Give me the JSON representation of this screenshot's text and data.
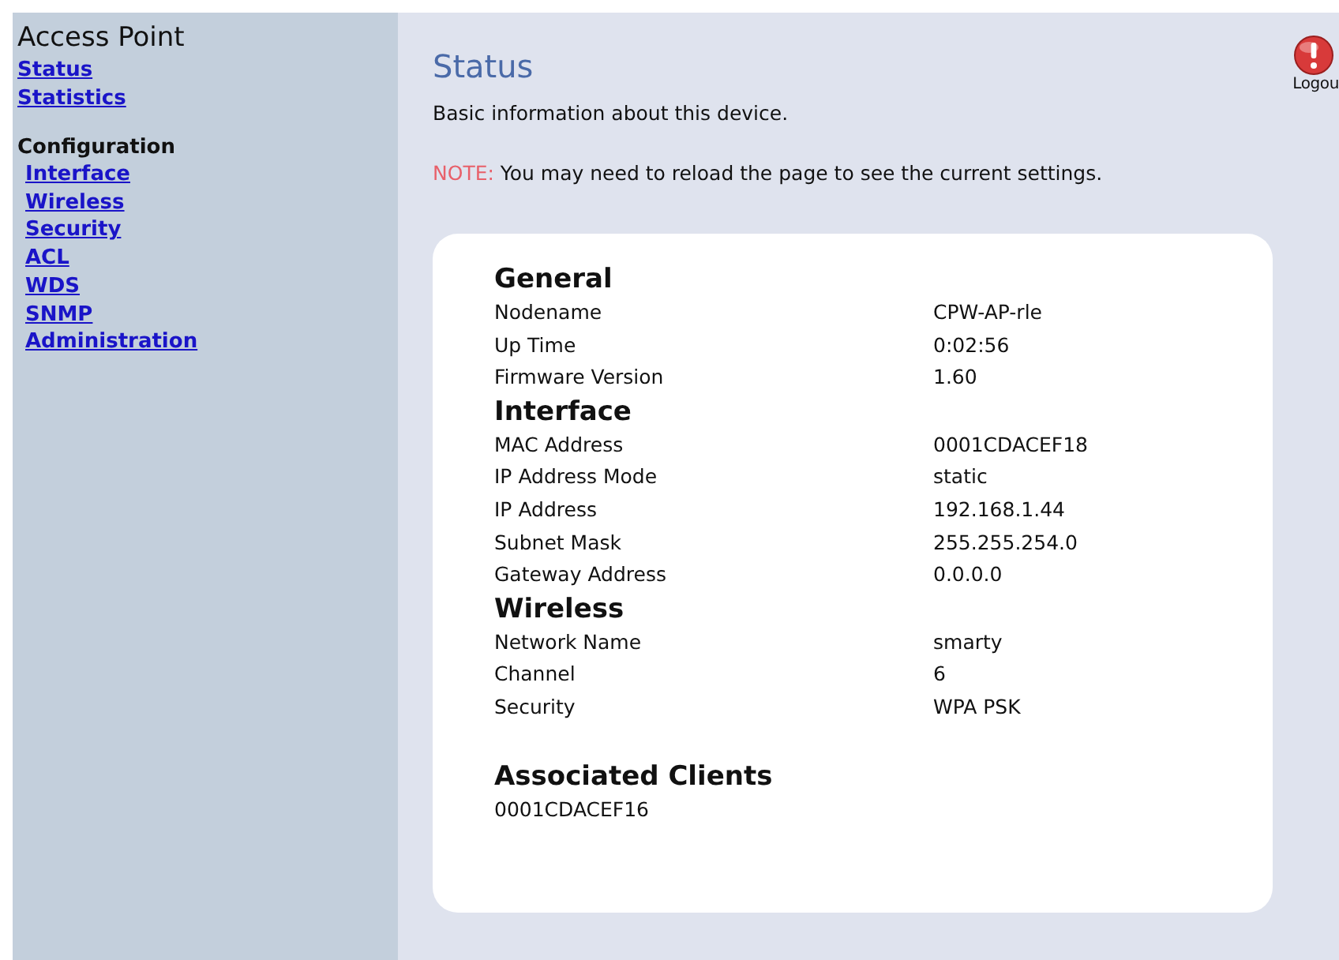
{
  "sidebar": {
    "title": "Access Point",
    "groups": [
      {
        "links": [
          "Status",
          "Statistics"
        ]
      },
      {
        "heading": "Configuration",
        "links": [
          "Interface",
          "Wireless",
          "Security",
          "ACL",
          "WDS",
          "SNMP",
          "Administration"
        ]
      }
    ]
  },
  "page": {
    "title": "Status",
    "description": "Basic information about this device.",
    "note_label": "NOTE:",
    "note": "You may need to reload the page to see the current settings.",
    "logout": "Logou"
  },
  "card": {
    "sections": [
      {
        "heading": "General",
        "rows": [
          {
            "label": "Nodename",
            "value": "CPW-AP-rle"
          },
          {
            "label": "Up Time",
            "value": "0:02:56"
          },
          {
            "label": "Firmware Version",
            "value": "1.60"
          }
        ]
      },
      {
        "heading": "Interface",
        "rows": [
          {
            "label": "MAC Address",
            "value": "0001CDACEF18"
          },
          {
            "label": "IP Address Mode",
            "value": "static"
          },
          {
            "label": "IP Address",
            "value": "192.168.1.44"
          },
          {
            "label": "Subnet Mask",
            "value": "255.255.254.0"
          },
          {
            "label": "Gateway Address",
            "value": "0.0.0.0"
          }
        ]
      },
      {
        "heading": "Wireless",
        "rows": [
          {
            "label": "Network Name",
            "value": "smarty"
          },
          {
            "label": "Channel",
            "value": "6"
          },
          {
            "label": "Security",
            "value": "WPA PSK"
          }
        ]
      }
    ],
    "clients": {
      "heading": "Associated Clients",
      "items": [
        "0001CDACEF16"
      ]
    }
  }
}
